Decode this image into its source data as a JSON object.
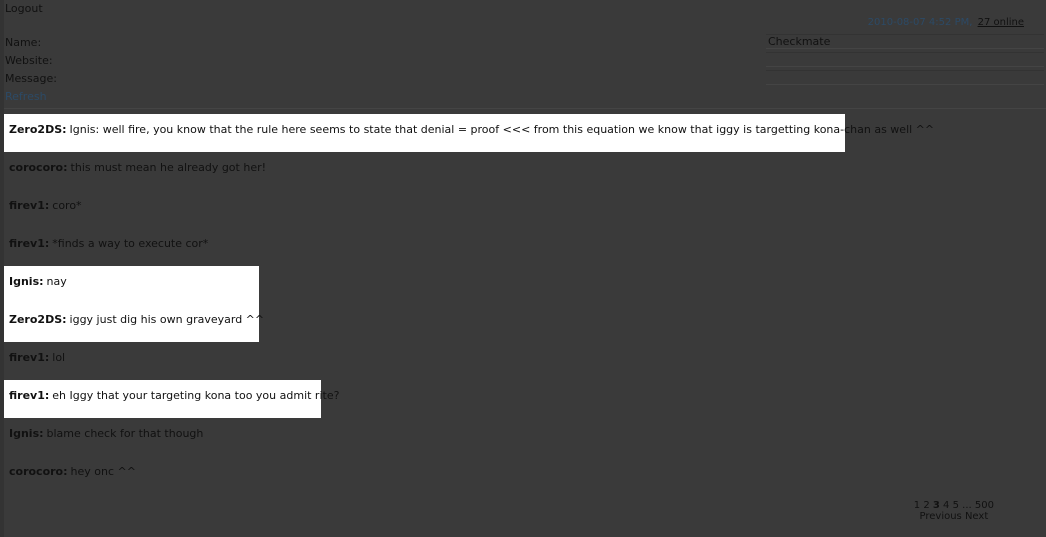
{
  "header": {
    "logout_label": "Logout",
    "timestamp": "2010-08-07 4:52 PM,",
    "online_label": "27 online"
  },
  "form": {
    "name_label": "Name:",
    "website_label": "Website:",
    "message_label": "Message:",
    "name_value": "Checkmate",
    "website_value": "",
    "message_value": "",
    "refresh_label": "Refresh"
  },
  "messages": [
    {
      "user": "Zero2DS:",
      "text": "Ignis: well fire, you know that the rule here seems to state that denial = proof <<< from this equation we know that iggy is targetting kona-chan as well ^^",
      "highlighted": true
    },
    {
      "user": "corocoro:",
      "text": "this must mean he already got her!",
      "highlighted": false
    },
    {
      "user": "firev1:",
      "text": "coro*",
      "highlighted": false
    },
    {
      "user": "firev1:",
      "text": "*finds a way to execute cor*",
      "highlighted": false
    },
    {
      "user": "Ignis:",
      "text": "nay",
      "highlighted": true
    },
    {
      "user": "Zero2DS:",
      "text": "iggy just dig his own graveyard ^^",
      "highlighted": true
    },
    {
      "user": "firev1:",
      "text": "lol",
      "highlighted": false
    },
    {
      "user": "firev1:",
      "text": "eh Iggy that your targeting kona too you admit rite?",
      "highlighted": true
    },
    {
      "user": "Ignis:",
      "text": "blame check for that though",
      "highlighted": false
    },
    {
      "user": "corocoro:",
      "text": "hey onc ^^",
      "highlighted": false
    }
  ],
  "pagination": {
    "pages": [
      "1",
      "2",
      "3",
      "4",
      "5",
      "...",
      "500"
    ],
    "previous_label": "Previous",
    "next_label": "Next"
  }
}
